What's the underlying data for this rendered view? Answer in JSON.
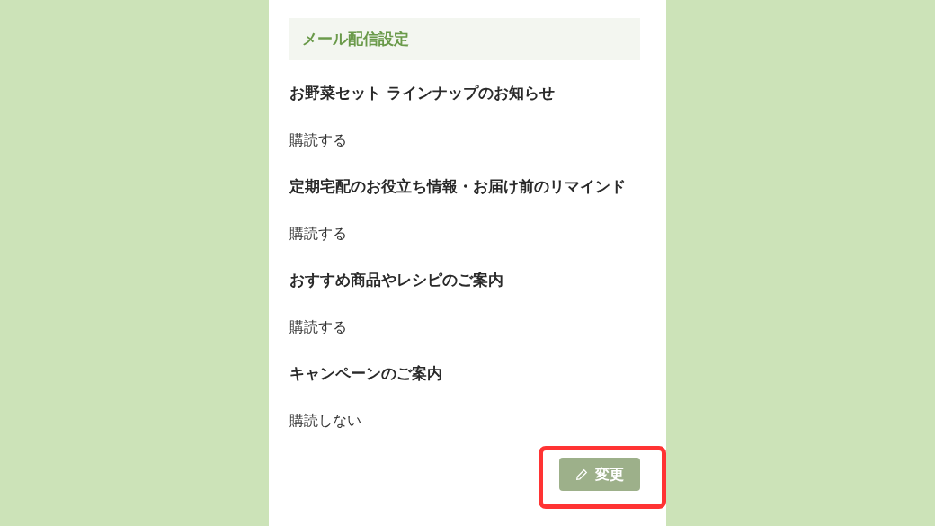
{
  "section_title": "メール配信設定",
  "settings": [
    {
      "title": "お野菜セット ラインナップのお知らせ",
      "value": "購読する"
    },
    {
      "title": "定期宅配のお役立ち情報・お届け前のリマインド",
      "value": "購読する"
    },
    {
      "title": "おすすめ商品やレシピのご案内",
      "value": "購読する"
    },
    {
      "title": "キャンペーンのご案内",
      "value": "購読しない"
    }
  ],
  "edit_button": {
    "label": "変更",
    "disabled": true,
    "highlighted": true
  }
}
